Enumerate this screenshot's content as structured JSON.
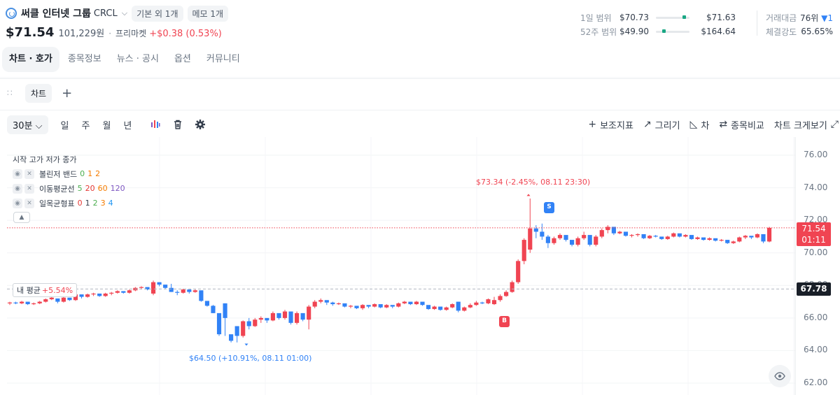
{
  "header": {
    "name": "써클 인터넷 그룹",
    "code": "CRCL",
    "pill_tags": "기본 외 1개",
    "pill_memo": "메모 1개",
    "price": "$71.54",
    "krw": "101,229원",
    "pre_label": "프리마켓",
    "pre_change": "+$0.38 (0.53%)"
  },
  "ranges": [
    {
      "label": "1일 범위",
      "low": "$70.73",
      "high": "$71.63",
      "position": 0.88
    },
    {
      "label": "52주 범위",
      "low": "$49.90",
      "high": "$164.64",
      "position": 0.2
    }
  ],
  "stats": {
    "volume_label": "거래대금",
    "volume_rank": "76위",
    "volume_change": "▼1",
    "strength_label": "체결강도",
    "strength_value": "65.65%"
  },
  "tabs": [
    "차트 · 호가",
    "종목정보",
    "뉴스 · 공시",
    "옵션",
    "커뮤니티"
  ],
  "chart_tab": "차트",
  "toolbar": {
    "interval": "30분",
    "periods": [
      "일",
      "주",
      "월",
      "년"
    ],
    "right": [
      "보조지표",
      "그리기",
      "차",
      "종목비교",
      "차트 크게보기"
    ]
  },
  "indicators": {
    "header": "시작 고가 저가 종가",
    "items": [
      {
        "name": "볼린저 밴드",
        "params": [
          "0",
          "1",
          "2"
        ]
      },
      {
        "name": "이동평균선",
        "params": [
          "5",
          "20",
          "60",
          "120"
        ]
      },
      {
        "name": "일목균형표",
        "params": [
          "0",
          "1",
          "2",
          "3",
          "4"
        ]
      }
    ]
  },
  "my_average": {
    "label": "내 평균",
    "pct": "+5.54%",
    "tag": "67.78"
  },
  "annotations": {
    "high": "$73.34 (-2.45%, 08.11 23:30)",
    "low": "$64.50 (+10.91%, 08.11 01:00)"
  },
  "markers": {
    "sell": "S",
    "buy": "B"
  },
  "last_price_tag": {
    "price": "71.54",
    "countdown": "01:11"
  },
  "colors": {
    "up": "#f04452",
    "down": "#3182f6",
    "accent": "#1aa784"
  },
  "chart_data": {
    "type": "candlestick",
    "ylim": [
      62,
      76
    ],
    "y_ticks": [
      "76.00",
      "74.00",
      "72.00",
      "70.00",
      "68.00",
      "66.00",
      "64.00",
      "62.00"
    ],
    "last_price": 71.54,
    "my_average": 67.78,
    "candles": [
      [
        66.9,
        67.0,
        66.8,
        66.95
      ],
      [
        66.95,
        67.0,
        66.85,
        66.9
      ],
      [
        66.9,
        67.05,
        66.85,
        67.0
      ],
      [
        67.0,
        66.95,
        66.8,
        66.85
      ],
      [
        66.85,
        66.95,
        66.8,
        66.9
      ],
      [
        66.9,
        67.05,
        66.85,
        67.0
      ],
      [
        67.0,
        67.2,
        66.95,
        67.15
      ],
      [
        67.15,
        67.3,
        67.1,
        67.25
      ],
      [
        67.2,
        67.05,
        66.9,
        67.0
      ],
      [
        67.0,
        67.3,
        66.95,
        67.25
      ],
      [
        67.25,
        67.15,
        67.05,
        67.1
      ],
      [
        67.1,
        67.5,
        67.05,
        67.45
      ],
      [
        67.45,
        67.4,
        67.2,
        67.3
      ],
      [
        67.3,
        67.5,
        67.25,
        67.45
      ],
      [
        67.45,
        67.55,
        67.35,
        67.5
      ],
      [
        67.5,
        67.45,
        67.3,
        67.35
      ],
      [
        67.35,
        67.55,
        67.3,
        67.5
      ],
      [
        67.5,
        67.6,
        67.4,
        67.55
      ],
      [
        67.55,
        67.7,
        67.5,
        67.65
      ],
      [
        67.65,
        67.6,
        67.5,
        67.55
      ],
      [
        67.55,
        67.75,
        67.5,
        67.7
      ],
      [
        67.7,
        67.9,
        67.65,
        67.85
      ],
      [
        67.85,
        67.95,
        67.75,
        67.9
      ],
      [
        67.9,
        67.8,
        67.7,
        67.75
      ],
      [
        67.5,
        68.3,
        67.4,
        68.2
      ],
      [
        68.2,
        68.15,
        67.95,
        68.05
      ],
      [
        68.05,
        67.9,
        67.8,
        67.85
      ],
      [
        67.85,
        68.1,
        67.6,
        67.6
      ],
      [
        67.6,
        67.7,
        67.4,
        67.55
      ],
      [
        67.55,
        67.8,
        67.5,
        67.75
      ],
      [
        67.75,
        67.65,
        67.5,
        67.6
      ],
      [
        67.6,
        67.75,
        67.55,
        67.7
      ],
      [
        67.7,
        67.55,
        67.0,
        67.05
      ],
      [
        67.05,
        67.0,
        66.7,
        66.75
      ],
      [
        66.75,
        66.8,
        66.3,
        66.3
      ],
      [
        66.3,
        66.0,
        64.9,
        65.0
      ],
      [
        66.9,
        66.9,
        64.9,
        66.0
      ],
      [
        65.0,
        64.9,
        64.5,
        64.6
      ],
      [
        65.5,
        65.5,
        64.5,
        64.9
      ],
      [
        64.9,
        65.85,
        64.8,
        65.8
      ],
      [
        65.8,
        66.0,
        65.3,
        65.5
      ],
      [
        65.5,
        66.0,
        65.45,
        65.9
      ],
      [
        65.9,
        66.1,
        65.7,
        66.0
      ],
      [
        66.0,
        65.95,
        65.7,
        65.85
      ],
      [
        65.85,
        66.4,
        65.8,
        66.3
      ],
      [
        66.3,
        66.15,
        65.9,
        66.0
      ],
      [
        66.0,
        66.5,
        65.9,
        66.4
      ],
      [
        66.4,
        66.0,
        65.6,
        65.7
      ],
      [
        65.7,
        66.4,
        65.6,
        66.3
      ],
      [
        66.3,
        66.2,
        65.8,
        65.9
      ],
      [
        65.9,
        66.8,
        65.3,
        66.7
      ],
      [
        66.7,
        67.1,
        66.6,
        67.0
      ],
      [
        67.0,
        67.2,
        66.9,
        67.1
      ],
      [
        67.1,
        67.0,
        66.8,
        66.95
      ],
      [
        66.95,
        67.0,
        66.75,
        66.85
      ],
      [
        66.85,
        66.95,
        66.8,
        66.9
      ],
      [
        66.9,
        66.8,
        66.65,
        66.7
      ],
      [
        66.7,
        66.8,
        66.6,
        66.75
      ],
      [
        66.75,
        66.7,
        66.55,
        66.6
      ],
      [
        66.6,
        66.85,
        66.5,
        66.8
      ],
      [
        66.8,
        66.75,
        66.6,
        66.7
      ],
      [
        66.7,
        66.9,
        66.65,
        66.85
      ],
      [
        66.85,
        66.7,
        66.6,
        66.65
      ],
      [
        66.65,
        66.85,
        66.6,
        66.8
      ],
      [
        66.8,
        66.75,
        66.6,
        66.7
      ],
      [
        66.7,
        66.95,
        66.65,
        66.9
      ],
      [
        66.9,
        67.05,
        66.85,
        67.0
      ],
      [
        67.0,
        66.95,
        66.8,
        66.85
      ],
      [
        66.85,
        67.05,
        66.8,
        67.0
      ],
      [
        67.0,
        66.85,
        66.75,
        66.8
      ],
      [
        66.8,
        66.65,
        66.5,
        66.55
      ],
      [
        66.55,
        66.75,
        66.5,
        66.7
      ],
      [
        66.7,
        66.6,
        66.45,
        66.5
      ],
      [
        66.5,
        66.7,
        66.45,
        66.65
      ],
      [
        66.65,
        66.9,
        66.6,
        66.85
      ],
      [
        67.0,
        67.0,
        66.35,
        66.45
      ],
      [
        66.45,
        66.7,
        66.4,
        66.65
      ],
      [
        66.65,
        66.9,
        66.6,
        66.8
      ],
      [
        66.8,
        67.05,
        66.75,
        66.95
      ],
      [
        66.95,
        67.0,
        66.85,
        66.9
      ],
      [
        66.9,
        67.2,
        66.85,
        67.15
      ],
      [
        66.85,
        67.3,
        66.8,
        67.1
      ],
      [
        67.1,
        67.45,
        67.0,
        67.35
      ],
      [
        67.35,
        67.7,
        67.3,
        67.6
      ],
      [
        67.6,
        68.3,
        67.55,
        68.2
      ],
      [
        68.2,
        69.6,
        68.1,
        69.5
      ],
      [
        69.5,
        70.9,
        69.3,
        70.8
      ],
      [
        70.2,
        73.34,
        70.0,
        71.5
      ],
      [
        71.5,
        71.7,
        70.9,
        71.3
      ],
      [
        71.3,
        71.8,
        70.8,
        71.0
      ],
      [
        71.0,
        71.1,
        70.3,
        70.6
      ],
      [
        70.6,
        71.0,
        70.5,
        70.9
      ],
      [
        70.9,
        71.2,
        70.8,
        71.1
      ],
      [
        71.1,
        71.0,
        70.7,
        70.8
      ],
      [
        70.8,
        70.6,
        70.4,
        70.5
      ],
      [
        70.5,
        71.0,
        70.4,
        70.9
      ],
      [
        70.9,
        71.3,
        70.8,
        71.1
      ],
      [
        71.1,
        70.7,
        70.4,
        70.5
      ],
      [
        70.5,
        71.1,
        70.4,
        71.0
      ],
      [
        71.0,
        71.5,
        70.9,
        71.4
      ],
      [
        71.4,
        71.7,
        71.2,
        71.6
      ],
      [
        71.6,
        71.3,
        71.1,
        71.2
      ],
      [
        71.2,
        71.35,
        71.15,
        71.3
      ],
      [
        71.3,
        71.2,
        71.0,
        71.05
      ],
      [
        71.05,
        71.15,
        70.95,
        71.1
      ],
      [
        71.1,
        71.2,
        71.0,
        71.15
      ],
      [
        71.15,
        71.0,
        70.85,
        70.9
      ],
      [
        70.9,
        71.1,
        70.85,
        71.05
      ],
      [
        71.05,
        71.1,
        70.95,
        71.0
      ],
      [
        71.0,
        70.95,
        70.8,
        70.85
      ],
      [
        70.85,
        71.05,
        70.8,
        71.0
      ],
      [
        71.0,
        71.25,
        70.95,
        71.2
      ],
      [
        71.2,
        71.1,
        70.95,
        71.0
      ],
      [
        71.0,
        71.15,
        70.95,
        71.1
      ],
      [
        71.1,
        70.95,
        70.8,
        70.85
      ],
      [
        70.85,
        71.0,
        70.8,
        70.95
      ],
      [
        70.95,
        70.85,
        70.75,
        70.8
      ],
      [
        70.8,
        70.95,
        70.75,
        70.9
      ],
      [
        70.9,
        70.8,
        70.7,
        70.75
      ],
      [
        70.75,
        70.85,
        70.7,
        70.8
      ],
      [
        70.8,
        70.65,
        70.55,
        70.6
      ],
      [
        70.6,
        70.75,
        70.55,
        70.7
      ],
      [
        70.7,
        71.0,
        70.65,
        70.95
      ],
      [
        70.95,
        71.1,
        70.85,
        71.05
      ],
      [
        71.05,
        71.0,
        70.85,
        70.95
      ],
      [
        70.95,
        71.2,
        70.9,
        71.15
      ],
      [
        71.15,
        70.8,
        70.6,
        70.7
      ],
      [
        70.7,
        71.6,
        70.65,
        71.54
      ]
    ]
  }
}
